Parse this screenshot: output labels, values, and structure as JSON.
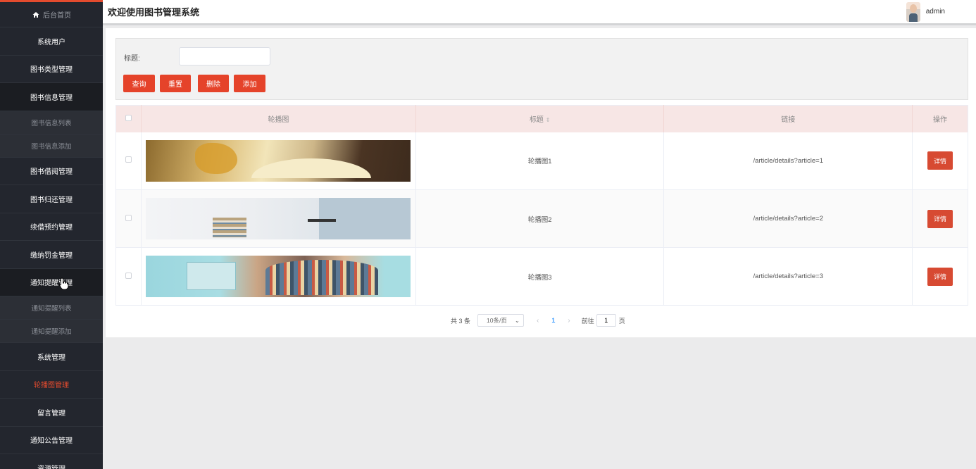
{
  "sidebar": {
    "home_label": "后台首页",
    "items": [
      {
        "label": "系统用户"
      },
      {
        "label": "图书类型管理"
      },
      {
        "label": "图书信息管理"
      },
      {
        "label": "图书信息列表"
      },
      {
        "label": "图书信息添加"
      },
      {
        "label": "图书借阅管理"
      },
      {
        "label": "图书归还管理"
      },
      {
        "label": "续借预约管理"
      },
      {
        "label": "缴纳罚金管理"
      },
      {
        "label": "通知提醒管理"
      },
      {
        "label": "通知提醒列表"
      },
      {
        "label": "通知提醒添加"
      },
      {
        "label": "系统管理"
      },
      {
        "label": "轮播图管理"
      },
      {
        "label": "留言管理"
      },
      {
        "label": "通知公告管理"
      },
      {
        "label": "资源管理"
      }
    ]
  },
  "header": {
    "title": "欢迎使用图书管理系统",
    "username": "admin"
  },
  "search": {
    "label": "标题:",
    "value": "",
    "placeholder": ""
  },
  "buttons": {
    "query": "查询",
    "reset": "重置",
    "delete": "删除",
    "add": "添加"
  },
  "table": {
    "columns": {
      "image": "轮播图",
      "title": "标题",
      "link": "链接",
      "action": "操作"
    },
    "rows": [
      {
        "title": "轮播图1",
        "link": "/article/details?article=1",
        "action": "详情"
      },
      {
        "title": "轮播图2",
        "link": "/article/details?article=2",
        "action": "详情"
      },
      {
        "title": "轮播图3",
        "link": "/article/details?article=3",
        "action": "详情"
      }
    ]
  },
  "pagination": {
    "total": "共 3 条",
    "page_size": "10条/页",
    "prev": "‹",
    "current": "1",
    "next": "›",
    "goto": "前往",
    "jump_value": "1",
    "page_suffix": "页"
  },
  "colors": {
    "accent": "#e5432a",
    "sidebar_bg": "#23262e",
    "header_row_bg": "#f7e6e5"
  }
}
